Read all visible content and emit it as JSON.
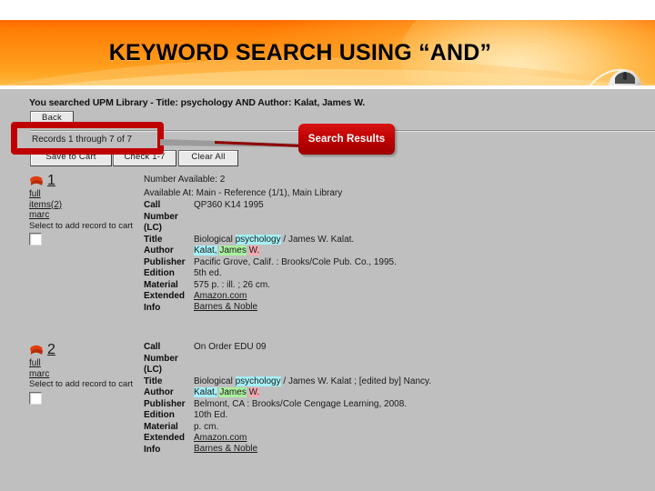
{
  "slide": {
    "title": "KEYWORD SEARCH USING “AND”",
    "accent_orange": "#ff8c10",
    "accent_red": "#c00000"
  },
  "screen": {
    "searched_prefix": "You searched UPM Library - Title: ",
    "searched_query": "psychology",
    "searched_mid": " AND Author: ",
    "searched_author": "Kalat, James W.",
    "searched_full": "You searched UPM Library - Title: psychology AND Author: Kalat, James W.",
    "back_button": "Back",
    "records_count": "Records 1 through 7 of 7",
    "save_cart_button": "Save to Cart",
    "check_button": "Check 1-7",
    "clear_all_button": "Clear All",
    "callout_label": "Search Results",
    "select_to_add": "Select to add record to cart"
  },
  "records": [
    {
      "number": "1",
      "links": [
        "full",
        "items(2)",
        "marc"
      ],
      "number_available": "Number Available: 2",
      "available_at": "Available At: Main - Reference (1/1), Main Library",
      "fields": [
        {
          "label": "Call\nNumber\n(LC)",
          "value": "QP360 K14 1995"
        },
        {
          "label": "Title",
          "value_pre": "Biological ",
          "value_hl": "psychology",
          "value_post": " / James W. Kalat."
        },
        {
          "label": "Author",
          "value_hl1": "Kalat,",
          "value_hl2": "James",
          "value_hl3": "W."
        },
        {
          "label": "Publisher",
          "value": "Pacific Grove, Calif. : Brooks/Cole Pub. Co., 1995."
        },
        {
          "label": "Edition",
          "value": "5th ed."
        },
        {
          "label": "Material",
          "value": "575 p. : ill. ; 26 cm."
        },
        {
          "label": "Extended\nInfo",
          "value": "Amazon.com",
          "value2": "Barnes & Noble"
        }
      ]
    },
    {
      "number": "2",
      "links": [
        "full",
        "marc"
      ],
      "number_available": "",
      "available_at": "",
      "fields": [
        {
          "label": "Call\nNumber\n(LC)",
          "value": "On Order EDU 09"
        },
        {
          "label": "Title",
          "value_pre": "Biological ",
          "value_hl": "psychology",
          "value_post": " / James W. Kalat ; [edited by] Nancy."
        },
        {
          "label": "Author",
          "value_hl1": "Kalat,",
          "value_hl2": "James",
          "value_hl3": "W."
        },
        {
          "label": "Publisher",
          "value": "Belmont, CA : Brooks/Cole Cengage Learning, 2008."
        },
        {
          "label": "Edition",
          "value": "10th Ed."
        },
        {
          "label": "Material",
          "value": "p. cm."
        },
        {
          "label": "Extended\nInfo",
          "value": "Amazon.com",
          "value2": "Barnes & Noble"
        }
      ]
    }
  ]
}
